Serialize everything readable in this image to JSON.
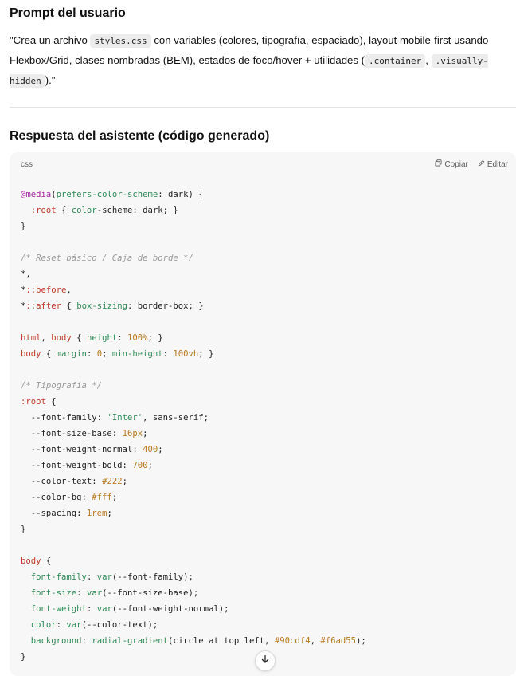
{
  "prompt": {
    "title": "Prompt del usuario",
    "segments": [
      {
        "t": "text",
        "v": "\"Crea un archivo "
      },
      {
        "t": "code",
        "v": "styles.css"
      },
      {
        "t": "text",
        "v": " con variables (colores, tipografía, espaciado), layout mobile-first usando Flexbox/Grid, clases nombradas (BEM), estados de foco/hover + utilidades ("
      },
      {
        "t": "code",
        "v": ".container"
      },
      {
        "t": "text",
        "v": ", "
      },
      {
        "t": "code",
        "v": ".visually-hidden"
      },
      {
        "t": "text",
        "v": ").\""
      }
    ]
  },
  "response": {
    "title": "Respuesta del asistente (código generado)",
    "code_block": {
      "language": "css",
      "copy_label": "Copiar",
      "edit_label": "Editar",
      "lines": [
        [
          [
            "at",
            "@media"
          ],
          [
            "",
            "("
          ],
          [
            "prop",
            "prefers-color-scheme"
          ],
          [
            "",
            ": dark) {"
          ]
        ],
        [
          [
            "",
            "  "
          ],
          [
            "sel",
            ":root"
          ],
          [
            "",
            " { "
          ],
          [
            "prop",
            "color"
          ],
          [
            "",
            "-scheme: dark; }"
          ]
        ],
        [
          [
            "",
            "}"
          ]
        ],
        [],
        [
          [
            "cm",
            "/* Reset básico / Caja de borde */"
          ]
        ],
        [
          [
            "",
            "*,"
          ]
        ],
        [
          [
            "",
            "*"
          ],
          [
            "sel",
            "::before"
          ],
          [
            "",
            ","
          ]
        ],
        [
          [
            "",
            "*"
          ],
          [
            "sel",
            "::after"
          ],
          [
            "",
            " { "
          ],
          [
            "prop",
            "box-sizing"
          ],
          [
            "",
            ": border-box; }"
          ]
        ],
        [],
        [
          [
            "sel",
            "html"
          ],
          [
            "",
            ", "
          ],
          [
            "sel",
            "body"
          ],
          [
            "",
            " { "
          ],
          [
            "prop",
            "height"
          ],
          [
            "",
            ": "
          ],
          [
            "num",
            "100%"
          ],
          [
            "",
            "; }"
          ]
        ],
        [
          [
            "sel",
            "body"
          ],
          [
            "",
            " { "
          ],
          [
            "prop",
            "margin"
          ],
          [
            "",
            ": "
          ],
          [
            "num",
            "0"
          ],
          [
            "",
            "; "
          ],
          [
            "prop",
            "min-height"
          ],
          [
            "",
            ": "
          ],
          [
            "num",
            "100vh"
          ],
          [
            "",
            "; }"
          ]
        ],
        [],
        [
          [
            "cm",
            "/* Tipografía */"
          ]
        ],
        [
          [
            "sel",
            ":root"
          ],
          [
            "",
            " {"
          ]
        ],
        [
          [
            "",
            "  --font-family: "
          ],
          [
            "str",
            "'Inter'"
          ],
          [
            "",
            ", sans-serif;"
          ]
        ],
        [
          [
            "",
            "  --font-size-base: "
          ],
          [
            "num",
            "16px"
          ],
          [
            "",
            ";"
          ]
        ],
        [
          [
            "",
            "  --font-weight-normal: "
          ],
          [
            "num",
            "400"
          ],
          [
            "",
            ";"
          ]
        ],
        [
          [
            "",
            "  --font-weight-bold: "
          ],
          [
            "num",
            "700"
          ],
          [
            "",
            ";"
          ]
        ],
        [
          [
            "",
            "  --color-text: "
          ],
          [
            "num",
            "#222"
          ],
          [
            "",
            ";"
          ]
        ],
        [
          [
            "",
            "  --color-bg: "
          ],
          [
            "num",
            "#fff"
          ],
          [
            "",
            ";"
          ]
        ],
        [
          [
            "",
            "  --spacing: "
          ],
          [
            "num",
            "1rem"
          ],
          [
            "",
            ";"
          ]
        ],
        [
          [
            "",
            "}"
          ]
        ],
        [],
        [
          [
            "sel",
            "body"
          ],
          [
            "",
            " {"
          ]
        ],
        [
          [
            "",
            "  "
          ],
          [
            "prop",
            "font-family"
          ],
          [
            "",
            ": "
          ],
          [
            "fn",
            "var"
          ],
          [
            "",
            "(--font-family);"
          ]
        ],
        [
          [
            "",
            "  "
          ],
          [
            "prop",
            "font-size"
          ],
          [
            "",
            ": "
          ],
          [
            "fn",
            "var"
          ],
          [
            "",
            "(--font-size-base);"
          ]
        ],
        [
          [
            "",
            "  "
          ],
          [
            "prop",
            "font-weight"
          ],
          [
            "",
            ": "
          ],
          [
            "fn",
            "var"
          ],
          [
            "",
            "(--font-weight-normal);"
          ]
        ],
        [
          [
            "",
            "  "
          ],
          [
            "prop",
            "color"
          ],
          [
            "",
            ": "
          ],
          [
            "fn",
            "var"
          ],
          [
            "",
            "(--color-text);"
          ]
        ],
        [
          [
            "",
            "  "
          ],
          [
            "prop",
            "background"
          ],
          [
            "",
            ": "
          ],
          [
            "fn",
            "radial-gradient"
          ],
          [
            "",
            "(circle at top left, "
          ],
          [
            "num",
            "#90cdf4"
          ],
          [
            "",
            ", "
          ],
          [
            "num",
            "#f6ad55"
          ],
          [
            "",
            ");"
          ]
        ],
        [
          [
            "",
            "}"
          ]
        ]
      ]
    }
  },
  "icons": {
    "copy": "copy-icon",
    "edit": "edit-icon",
    "scroll": "arrow-down-icon"
  }
}
